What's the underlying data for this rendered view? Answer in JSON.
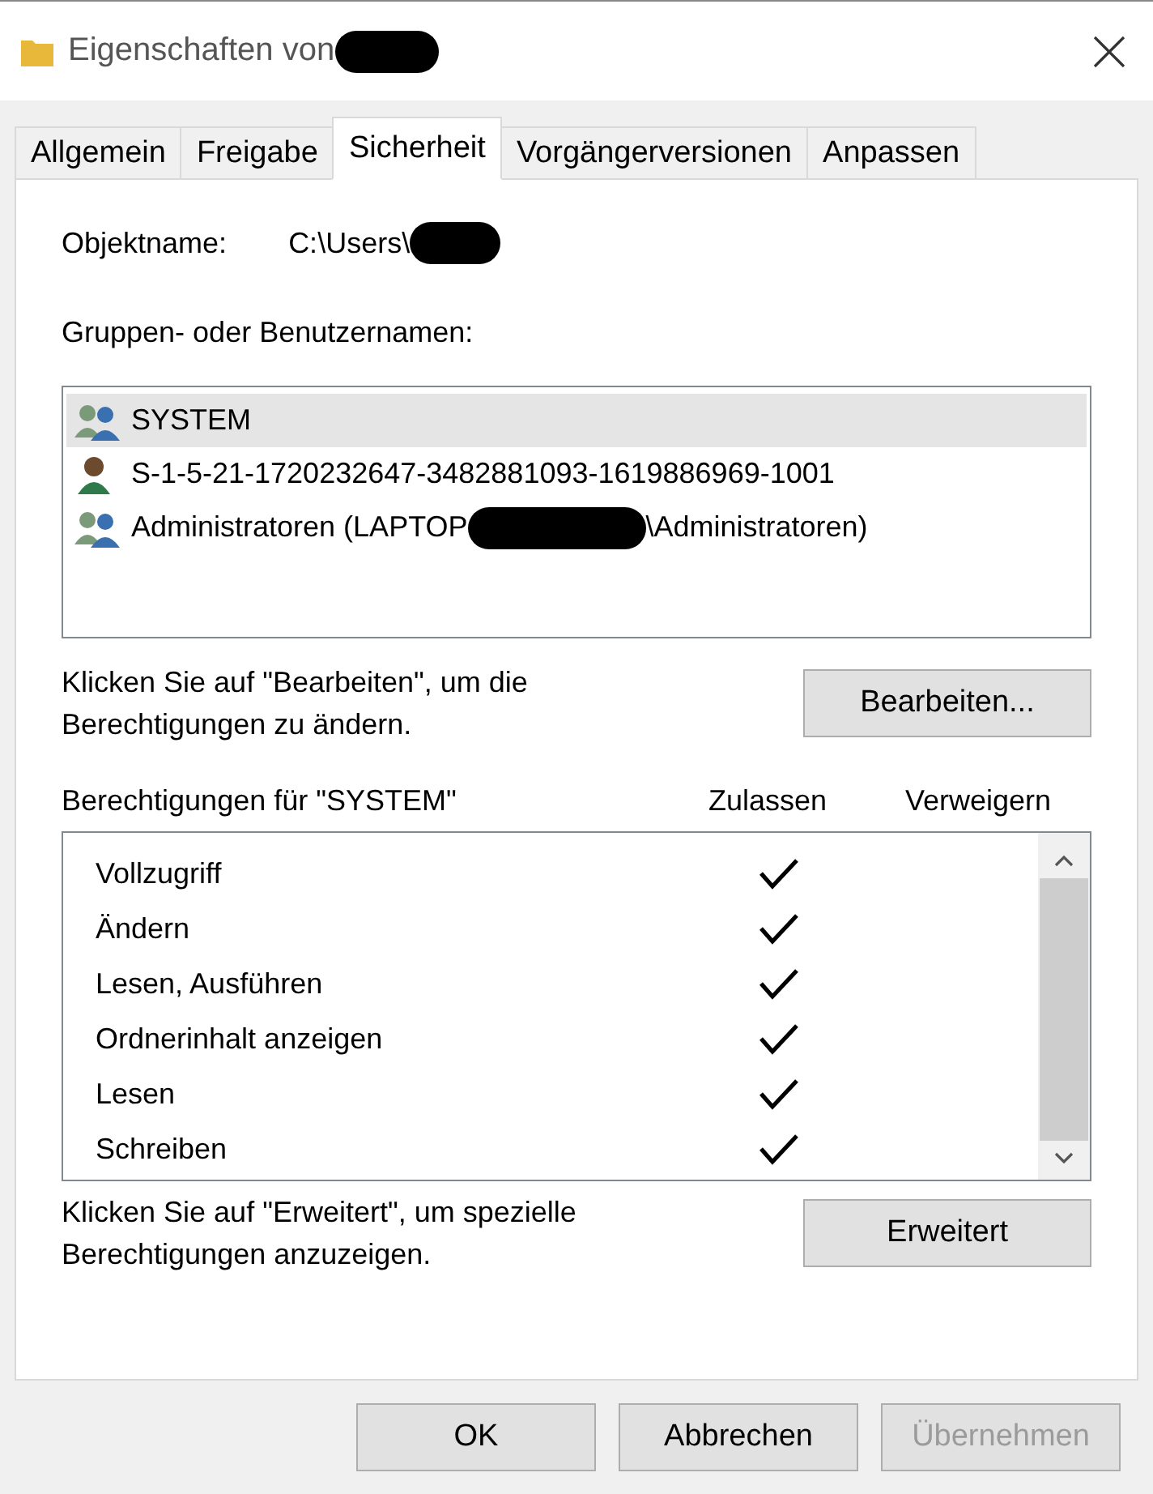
{
  "window": {
    "title": "Eigenschaften von",
    "title_redacted": true
  },
  "tabs": [
    {
      "label": "Allgemein",
      "selected": false
    },
    {
      "label": "Freigabe",
      "selected": false
    },
    {
      "label": "Sicherheit",
      "selected": true
    },
    {
      "label": "Vorgängerversionen",
      "selected": false
    },
    {
      "label": "Anpassen",
      "selected": false
    }
  ],
  "object_name": {
    "label": "Objektname:",
    "value": "C:\\Users\\",
    "redacted": true
  },
  "users_label": "Gruppen- oder Benutzernamen:",
  "users": [
    {
      "kind": "group",
      "name": "SYSTEM",
      "selected": true
    },
    {
      "kind": "user",
      "name": "S-1-5-21-1720232647-3482881093-1619886969-1001",
      "selected": false
    },
    {
      "kind": "group",
      "name": "Administratoren (LAPTOP",
      "name_after": "\\Administratoren)",
      "selected": false
    }
  ],
  "edit_hint": "Klicken Sie auf \"Bearbeiten\", um die Berechtigungen zu ändern.",
  "edit_button": "Bearbeiten...",
  "permissions_label": "Berechtigungen für \"SYSTEM\"",
  "allow_header": "Zulassen",
  "deny_header": "Verweigern",
  "permissions": [
    {
      "name": "Vollzugriff",
      "allow": true,
      "deny": false
    },
    {
      "name": "Ändern",
      "allow": true,
      "deny": false
    },
    {
      "name": "Lesen, Ausführen",
      "allow": true,
      "deny": false
    },
    {
      "name": "Ordnerinhalt anzeigen",
      "allow": true,
      "deny": false
    },
    {
      "name": "Lesen",
      "allow": true,
      "deny": false
    },
    {
      "name": "Schreiben",
      "allow": true,
      "deny": false
    }
  ],
  "advanced_hint": "Klicken Sie auf \"Erweitert\", um spezielle Berechtigungen anzuzeigen.",
  "advanced_button": "Erweitert",
  "buttons": [
    {
      "label": "OK",
      "disabled": false
    },
    {
      "label": "Abbrechen",
      "disabled": false
    },
    {
      "label": "Übernehmen",
      "disabled": true
    }
  ]
}
